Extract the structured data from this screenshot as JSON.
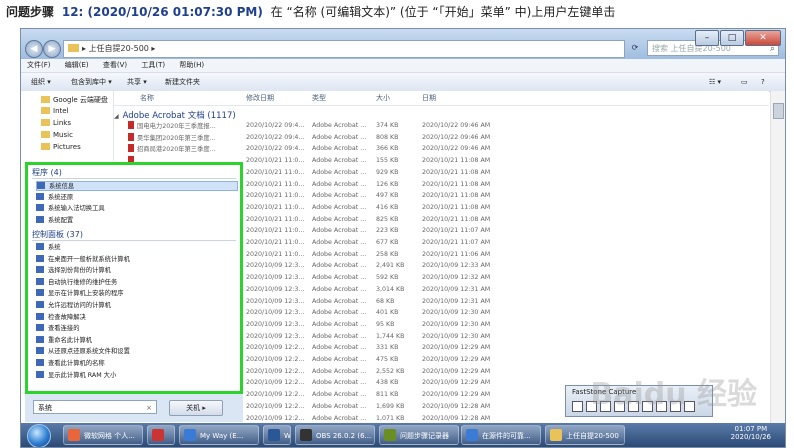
{
  "caption": {
    "step_label": "问题步骤",
    "step_meta": "12: (2020/10/26 01:07:30 PM)",
    "text": "在 “名称 (可编辑文本)” (位于 “「开始」菜单” 中)上用户左键单击"
  },
  "window": {
    "address": "▸ 上任自提20-500 ▸",
    "search_placeholder": "搜索 上任自提20-500",
    "controls": {
      "minimize": "–",
      "maximize": "□",
      "close": "✕"
    }
  },
  "menubar": [
    "文件(F)",
    "编辑(E)",
    "查看(V)",
    "工具(T)",
    "帮助(H)"
  ],
  "toolbar": {
    "organize": "组织 ▾",
    "include": "包含到库中 ▾",
    "share": "共享 ▾",
    "new_folder": "新建文件夹"
  },
  "nav": [
    "Google 云端硬盘",
    "Intel",
    "Links",
    "Music",
    "Pictures"
  ],
  "columns": {
    "name": "名称",
    "modified": "修改日期",
    "type": "类型",
    "size": "大小",
    "date": "日期"
  },
  "group": "Adobe Acrobat 文档 (1117)",
  "files": [
    {
      "name": "国电电力2020年三季度报...",
      "mod": "2020/10/22 09:4...",
      "type": "Adobe Acrobat ...",
      "size": "374 KB",
      "date": "2020/10/22 09:46 AM"
    },
    {
      "name": "昊华集团2020年第三季度...",
      "mod": "2020/10/22 09:4...",
      "type": "Adobe Acrobat ...",
      "size": "808 KB",
      "date": "2020/10/22 09:46 AM"
    },
    {
      "name": "招商局港2020年第三季度...",
      "mod": "2020/10/22 09:4...",
      "type": "Adobe Acrobat ...",
      "size": "366 KB",
      "date": "2020/10/22 09:46 AM"
    },
    {
      "name": "",
      "mod": "2020/10/21 11:0...",
      "type": "Adobe Acrobat ...",
      "size": "155 KB",
      "date": "2020/10/21 11:08 AM"
    },
    {
      "name": "",
      "mod": "2020/10/21 11:0...",
      "type": "Adobe Acrobat ...",
      "size": "929 KB",
      "date": "2020/10/21 11:08 AM"
    },
    {
      "name": "",
      "mod": "2020/10/21 11:0...",
      "type": "Adobe Acrobat ...",
      "size": "126 KB",
      "date": "2020/10/21 11:08 AM"
    },
    {
      "name": "",
      "mod": "2020/10/21 11:0...",
      "type": "Adobe Acrobat ...",
      "size": "497 KB",
      "date": "2020/10/21 11:08 AM"
    },
    {
      "name": "",
      "mod": "2020/10/21 11:0...",
      "type": "Adobe Acrobat ...",
      "size": "416 KB",
      "date": "2020/10/21 11:08 AM"
    },
    {
      "name": "",
      "mod": "2020/10/21 11:0...",
      "type": "Adobe Acrobat ...",
      "size": "825 KB",
      "date": "2020/10/21 11:08 AM"
    },
    {
      "name": "",
      "mod": "2020/10/21 11:0...",
      "type": "Adobe Acrobat ...",
      "size": "223 KB",
      "date": "2020/10/21 11:07 AM"
    },
    {
      "name": "",
      "mod": "2020/10/21 11:0...",
      "type": "Adobe Acrobat ...",
      "size": "677 KB",
      "date": "2020/10/21 11:07 AM"
    },
    {
      "name": "",
      "mod": "2020/10/21 11:0...",
      "type": "Adobe Acrobat ...",
      "size": "258 KB",
      "date": "2020/10/21 11:06 AM"
    },
    {
      "name": "",
      "mod": "2020/10/09 12:3...",
      "type": "Adobe Acrobat ...",
      "size": "2,491 KB",
      "date": "2020/10/09 12:33 AM"
    },
    {
      "name": "",
      "mod": "2020/10/09 12:3...",
      "type": "Adobe Acrobat ...",
      "size": "592 KB",
      "date": "2020/10/09 12:32 AM"
    },
    {
      "name": "",
      "mod": "2020/10/09 12:3...",
      "type": "Adobe Acrobat ...",
      "size": "3,014 KB",
      "date": "2020/10/09 12:31 AM"
    },
    {
      "name": "",
      "mod": "2020/10/09 12:3...",
      "type": "Adobe Acrobat ...",
      "size": "68 KB",
      "date": "2020/10/09 12:31 AM"
    },
    {
      "name": "",
      "mod": "2020/10/09 12:3...",
      "type": "Adobe Acrobat ...",
      "size": "401 KB",
      "date": "2020/10/09 12:30 AM"
    },
    {
      "name": "",
      "mod": "2020/10/09 12:3...",
      "type": "Adobe Acrobat ...",
      "size": "95 KB",
      "date": "2020/10/09 12:30 AM"
    },
    {
      "name": "",
      "mod": "2020/10/09 12:3...",
      "type": "Adobe Acrobat ...",
      "size": "1,744 KB",
      "date": "2020/10/09 12:30 AM"
    },
    {
      "name": "",
      "mod": "2020/10/09 12:2...",
      "type": "Adobe Acrobat ...",
      "size": "331 KB",
      "date": "2020/10/09 12:29 AM"
    },
    {
      "name": "",
      "mod": "2020/10/09 12:2...",
      "type": "Adobe Acrobat ...",
      "size": "475 KB",
      "date": "2020/10/09 12:29 AM"
    },
    {
      "name": "",
      "mod": "2020/10/09 12:2...",
      "type": "Adobe Acrobat ...",
      "size": "2,552 KB",
      "date": "2020/10/09 12:29 AM"
    },
    {
      "name": "",
      "mod": "2020/10/09 12:2...",
      "type": "Adobe Acrobat ...",
      "size": "438 KB",
      "date": "2020/10/09 12:29 AM"
    },
    {
      "name": "",
      "mod": "2020/10/09 12:2...",
      "type": "Adobe Acrobat ...",
      "size": "811 KB",
      "date": "2020/10/09 12:29 AM"
    },
    {
      "name": "",
      "mod": "2020/10/09 12:2...",
      "type": "Adobe Acrobat ...",
      "size": "1,699 KB",
      "date": "2020/10/09 12:28 AM"
    },
    {
      "name": "",
      "mod": "2020/10/09 12:2...",
      "type": "Adobe Acrobat ...",
      "size": "1,071 KB",
      "date": "2020/10/09 12:28 AM"
    }
  ],
  "start_menu": {
    "programs_header": "程序 (4)",
    "programs": [
      "系统信息",
      "系统还原",
      "系统输入法切换工具",
      "系统配置"
    ],
    "control_header": "控制面板 (37)",
    "control": [
      "系统",
      "在桌面开一般析就系统计算机",
      "选择别份背份的计算机",
      "自动执行维修的维护任务",
      "显示在计算机上安装的程序",
      "允许远程访问的计算机",
      "检查故障解决",
      "查看连接的",
      "重命名此计算机",
      "从还原点还原系统文件和设置",
      "查看此计算机的名称",
      "显示此计算机 RAM 大小"
    ],
    "search_value": "系统",
    "shutdown_label": "关机 ▸"
  },
  "faststone": {
    "title": "FastStone Capture"
  },
  "taskbar": {
    "items": [
      {
        "label": "微软网格 个人...",
        "color": "#e8663a"
      },
      {
        "label": "",
        "color": "#c33"
      },
      {
        "label": "My Way (E...",
        "color": "#3a7bd5"
      },
      {
        "label": "W",
        "color": "#2b5797"
      },
      {
        "label": "OBS 26.0.2 (6...",
        "color": "#333"
      },
      {
        "label": "问题步骤记录器",
        "color": "#6b8e23"
      },
      {
        "label": "在源件的可靠...",
        "color": "#3a7bd5"
      },
      {
        "label": "上任自提20-500",
        "color": "#e9c35a"
      }
    ],
    "time": "01:07 PM",
    "date": "2020/10/26"
  },
  "watermark": "Baidu 经验"
}
